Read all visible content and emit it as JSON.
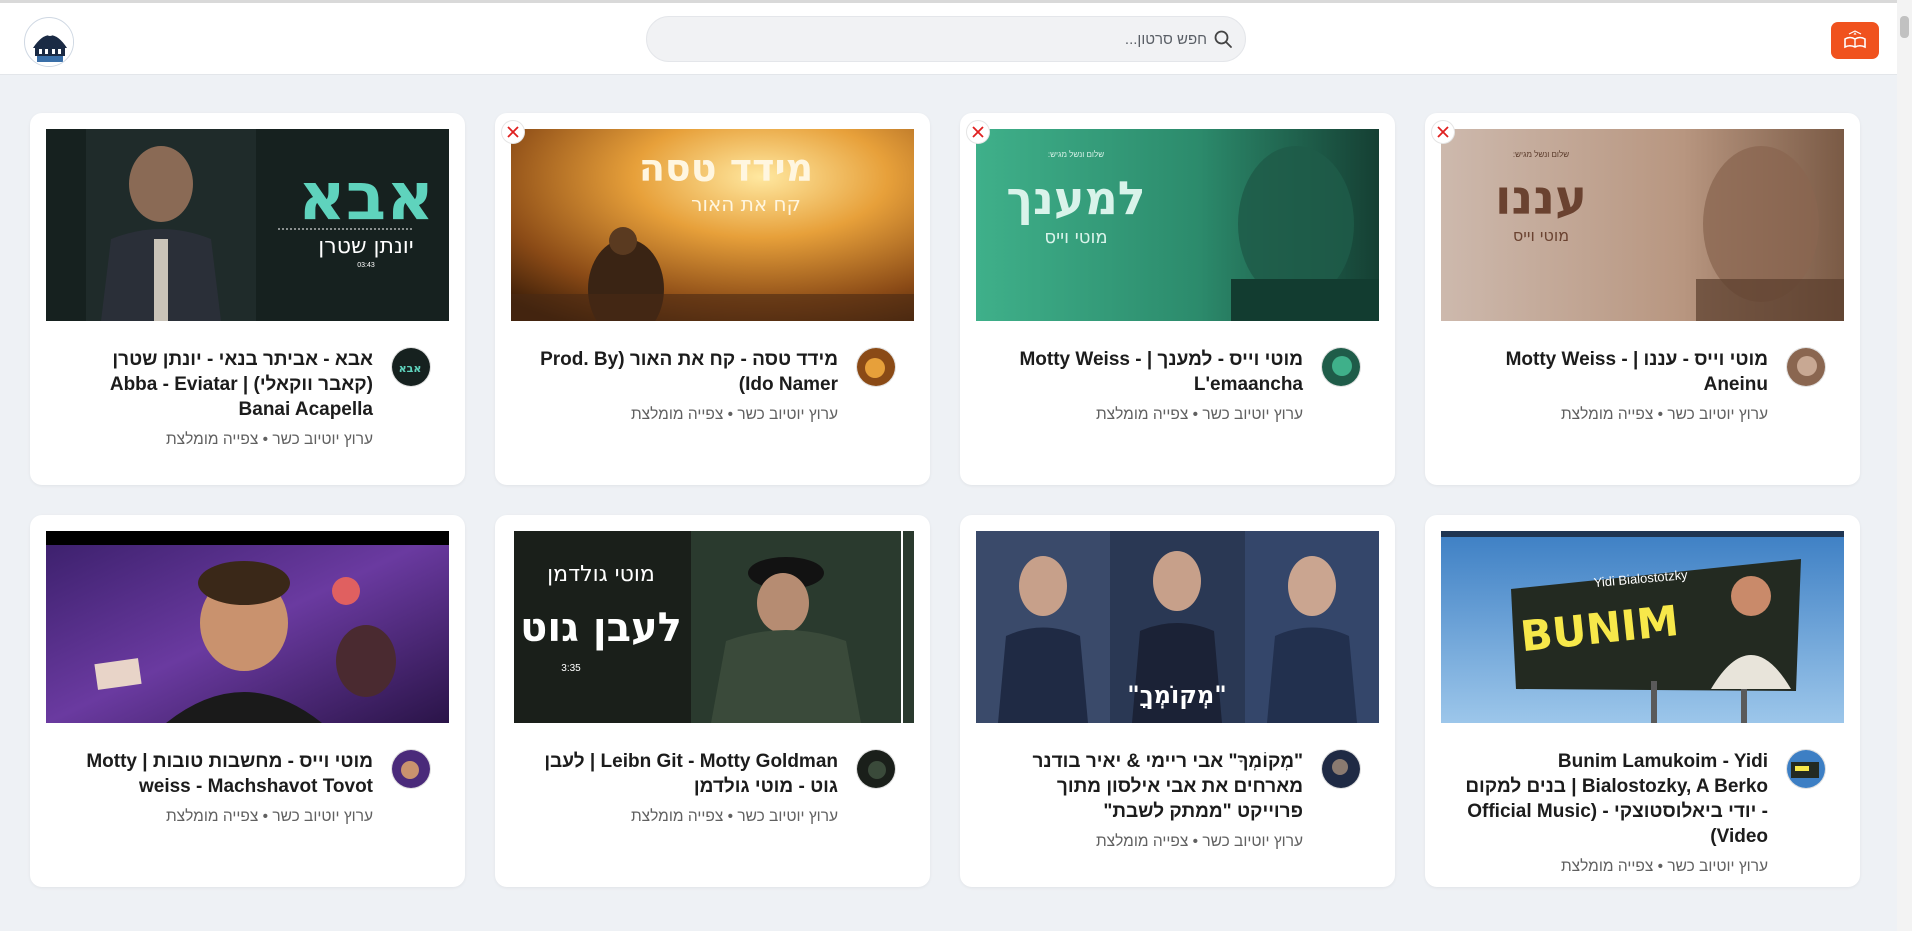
{
  "search": {
    "placeholder": "חפש סרטון..."
  },
  "cards": [
    {
      "title": "מוטי וייס - עננו | Motty Weiss - Aneinu",
      "channel": "ערוץ יוטיוב כשר",
      "tag": "צפייה מומלצת",
      "thumb_text_main": "עננו",
      "thumb_text_sub": "מוטי וייס",
      "thumb_top": "שלום ונשל מגיש:",
      "has_close": true
    },
    {
      "title": "מוטי וייס - למענך | Motty Weiss - L'emaancha",
      "channel": "ערוץ יוטיוב כשר",
      "tag": "צפייה מומלצת",
      "thumb_text_main": "למענך",
      "thumb_text_sub": "מוטי וייס",
      "thumb_top": "שלום ונשל מגיש:",
      "has_close": true
    },
    {
      "title": "מידד טסה - קח את האור (Prod. By Ido Namer)",
      "channel": "ערוץ יוטיוב כשר",
      "tag": "צפייה מומלצת",
      "thumb_text_main": "מידד טסה",
      "thumb_text_sub": "קח את האור",
      "has_close": true
    },
    {
      "title": "אבא - אביתר בנאי - יונתן שטרן (קאבר ווקאלי) | Abba - Eviatar Banai Acapella",
      "channel": "ערוץ יוטיוב כשר",
      "tag": "צפייה מומלצת",
      "thumb_text_main": "אבא",
      "thumb_text_sub": "יונתן שטרן",
      "thumb_time": "03:43",
      "has_close": false
    },
    {
      "title": "Bunim Lamukoim - Yidi Bialostozky, A Berko | בנים למקום - יודי ביאלוסטוצקי - (Official Music Video)",
      "channel": "ערוץ יוטיוב כשר",
      "tag": "צפייה מומלצת",
      "thumb_text_main": "BUNIM",
      "thumb_text_sub": "Yidi Bialostotzky",
      "has_close": false
    },
    {
      "title": "\"מְקוֹמְךָ\" אבי ריימי & יאיר בודנר מארחים את אבי אילסון מתוך פרוייקט \"ממתק לשבת\"",
      "channel": "ערוץ יוטיוב כשר",
      "tag": "צפייה מומלצת",
      "thumb_text_main": "\"מְקוֹמְךָ\"",
      "has_close": false
    },
    {
      "title": "Leibn Git - Motty Goldman | לעבן גוט - מוטי גולדמן",
      "channel": "ערוץ יוטיוב כשר",
      "tag": "צפייה מומלצת",
      "thumb_text_main": "לעבן גוט",
      "thumb_text_sub": "מוטי גולדמן",
      "thumb_time": "3:35",
      "has_close": false
    },
    {
      "title": "מוטי וייס - מחשבות טובות | Motty weiss - Machshavot Tovot",
      "channel": "ערוץ יוטיוב כשר",
      "tag": "צפייה מומלצת",
      "has_close": false
    }
  ],
  "colors": {
    "accent": "#f0521e",
    "close_x": "#e02020",
    "page_bg": "#eef1f5"
  }
}
